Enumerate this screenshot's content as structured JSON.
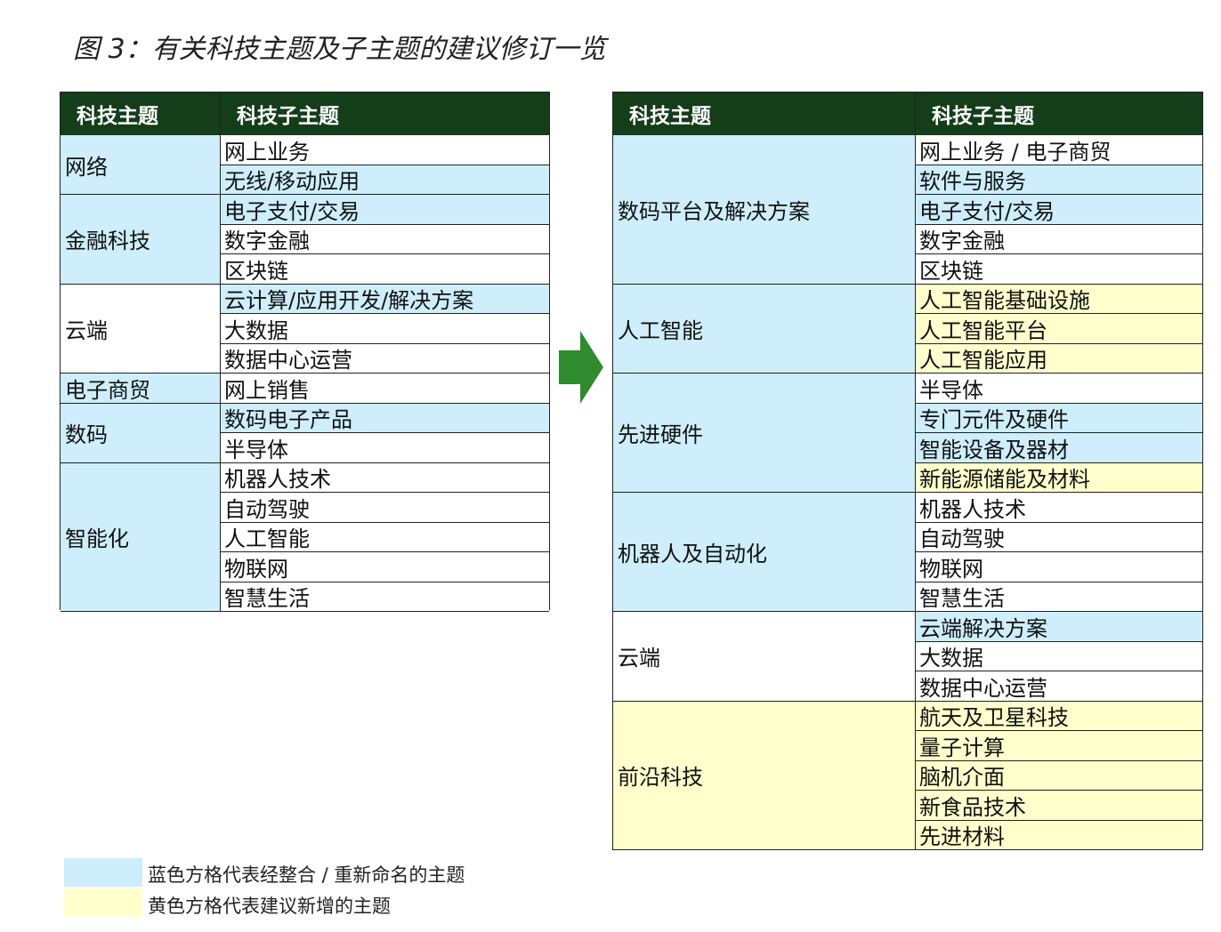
{
  "title": "图 3：有关科技主题及子主题的建议修订一览",
  "colors": {
    "header": "#143d1a",
    "blue": "#cdeefa",
    "yellow": "#ffffcc",
    "arrow": "#2e8b2e"
  },
  "left_table": {
    "header_main": "科技主题",
    "header_sub": "科技子主题",
    "groups": [
      {
        "name": "网络",
        "color": "blue",
        "subs": [
          {
            "text": "网上业务",
            "color": "white"
          },
          {
            "text": "无线/移动应用",
            "color": "blue"
          }
        ]
      },
      {
        "name": "金融科技",
        "color": "blue",
        "subs": [
          {
            "text": "电子支付/交易",
            "color": "blue"
          },
          {
            "text": "数字金融",
            "color": "white"
          },
          {
            "text": "区块链",
            "color": "white"
          }
        ]
      },
      {
        "name": "云端",
        "color": "white",
        "subs": [
          {
            "text": "云计算/应用开发/解决方案",
            "color": "blue"
          },
          {
            "text": "大数据",
            "color": "white"
          },
          {
            "text": "数据中心运营",
            "color": "white"
          }
        ]
      },
      {
        "name": "电子商贸",
        "color": "blue",
        "subs": [
          {
            "text": "网上销售",
            "color": "white"
          }
        ]
      },
      {
        "name": "数码",
        "color": "blue",
        "subs": [
          {
            "text": "数码电子产品",
            "color": "blue"
          },
          {
            "text": "半导体",
            "color": "white"
          }
        ]
      },
      {
        "name": "智能化",
        "color": "blue",
        "subs": [
          {
            "text": "机器人技术",
            "color": "white"
          },
          {
            "text": "自动驾驶",
            "color": "white"
          },
          {
            "text": "人工智能",
            "color": "white"
          },
          {
            "text": "物联网",
            "color": "white"
          },
          {
            "text": "智慧生活",
            "color": "white"
          }
        ]
      }
    ]
  },
  "right_table": {
    "header_main": "科技主题",
    "header_sub": "科技子主题",
    "groups": [
      {
        "name": "数码平台及解决方案",
        "color": "blue",
        "subs": [
          {
            "text": "网上业务 / 电子商贸",
            "color": "white"
          },
          {
            "text": "软件与服务",
            "color": "blue"
          },
          {
            "text": "电子支付/交易",
            "color": "blue"
          },
          {
            "text": "数字金融",
            "color": "white"
          },
          {
            "text": "区块链",
            "color": "white"
          }
        ]
      },
      {
        "name": "人工智能",
        "color": "blue",
        "subs": [
          {
            "text": "人工智能基础设施",
            "color": "yellow"
          },
          {
            "text": "人工智能平台",
            "color": "yellow"
          },
          {
            "text": "人工智能应用",
            "color": "yellow"
          }
        ]
      },
      {
        "name": "先进硬件",
        "color": "blue",
        "subs": [
          {
            "text": "半导体",
            "color": "white"
          },
          {
            "text": "专门元件及硬件",
            "color": "blue"
          },
          {
            "text": "智能设备及器材",
            "color": "blue"
          },
          {
            "text": "新能源储能及材料",
            "color": "yellow"
          }
        ]
      },
      {
        "name": "机器人及自动化",
        "color": "blue",
        "subs": [
          {
            "text": "机器人技术",
            "color": "white"
          },
          {
            "text": "自动驾驶",
            "color": "white"
          },
          {
            "text": "物联网",
            "color": "white"
          },
          {
            "text": "智慧生活",
            "color": "white"
          }
        ]
      },
      {
        "name": "云端",
        "color": "white",
        "subs": [
          {
            "text": "云端解决方案",
            "color": "blue"
          },
          {
            "text": "大数据",
            "color": "white"
          },
          {
            "text": "数据中心运营",
            "color": "white"
          }
        ]
      },
      {
        "name": "前沿科技",
        "color": "yellow",
        "subs": [
          {
            "text": "航天及卫星科技",
            "color": "yellow"
          },
          {
            "text": "量子计算",
            "color": "yellow"
          },
          {
            "text": "脑机介面",
            "color": "yellow"
          },
          {
            "text": "新食品技术",
            "color": "yellow"
          },
          {
            "text": "先进材料",
            "color": "yellow"
          }
        ]
      }
    ]
  },
  "legend": {
    "blue_text": "蓝色方格代表经整合 / 重新命名的主题",
    "yellow_text": "黄色方格代表建议新增的主题"
  }
}
